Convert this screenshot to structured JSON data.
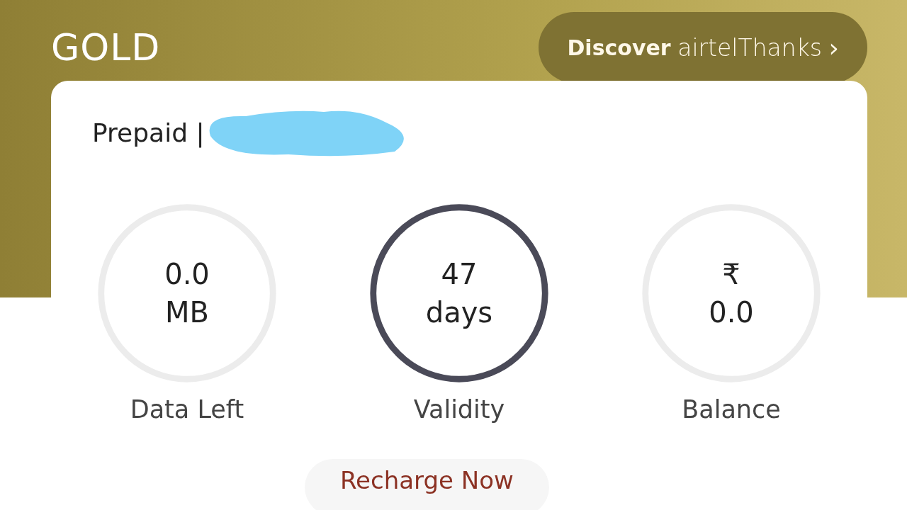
{
  "tier": {
    "title": "GOLD"
  },
  "discover_button": {
    "label": "Discover",
    "brand": "airtelThanks",
    "chevron": "›"
  },
  "account": {
    "label": "Prepaid |",
    "redacted": true
  },
  "metrics": [
    {
      "value_lines": [
        "0.0",
        "MB"
      ],
      "label": "Data Left",
      "highlighted": false
    },
    {
      "value_lines": [
        "47",
        "days"
      ],
      "label": "Validity",
      "highlighted": true
    },
    {
      "value_lines": [
        "₹",
        "0.0"
      ],
      "label": "Balance",
      "highlighted": false
    }
  ],
  "recharge_button": {
    "label": "Recharge Now"
  }
}
